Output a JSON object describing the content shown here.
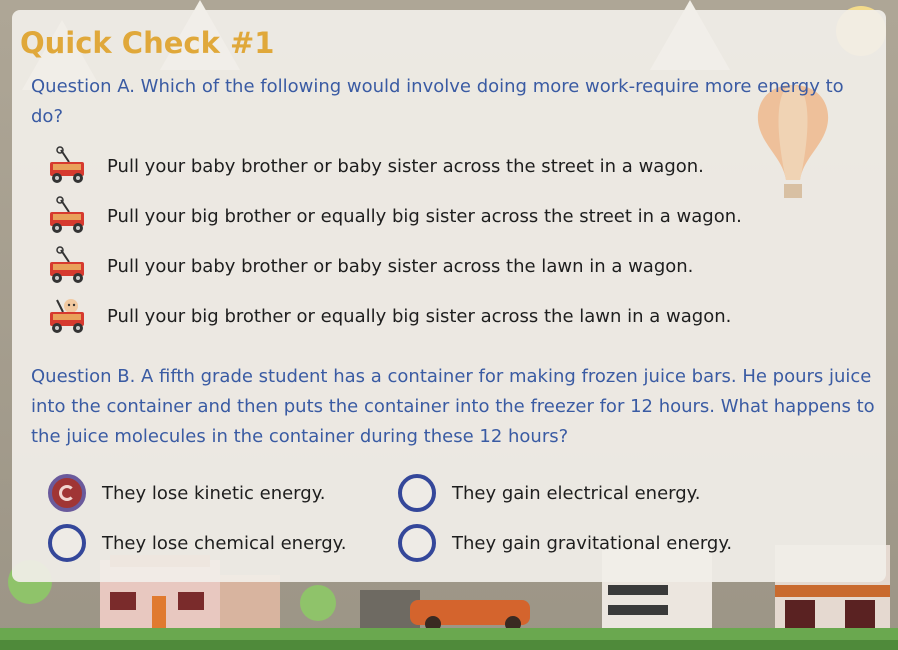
{
  "title": "Quick Check #1",
  "question_a": {
    "text": "Question A. Which of the following would involve doing more work-require more energy to do?",
    "options": [
      {
        "label": "Pull your baby brother or baby sister across the street in a wagon.",
        "icon": "wagon-icon"
      },
      {
        "label": "Pull your big brother or equally big sister across the street in a wagon.",
        "icon": "wagon-icon"
      },
      {
        "label": "Pull your baby brother or baby sister across the lawn in a wagon.",
        "icon": "wagon-icon"
      },
      {
        "label": "Pull your big brother or equally big sister across the lawn in a wagon.",
        "icon": "wagon-with-child-icon"
      }
    ]
  },
  "question_b": {
    "text": "Question B. A fifth grade student has a container for making frozen juice bars. He pours juice into the container and then puts the container into the freezer for 12 hours. What happens to the juice molecules in the container during these 12 hours?",
    "options": [
      {
        "label": "They lose kinetic energy.",
        "selected": true
      },
      {
        "label": "They gain electrical energy.",
        "selected": false
      },
      {
        "label": "They lose chemical energy.",
        "selected": false
      },
      {
        "label": "They gain gravitational energy.",
        "selected": false
      }
    ]
  },
  "colors": {
    "title": "#e0a83a",
    "question_text": "#3a5ba3",
    "radio_border": "#34479a",
    "radio_selected_fill": "#a03535"
  }
}
